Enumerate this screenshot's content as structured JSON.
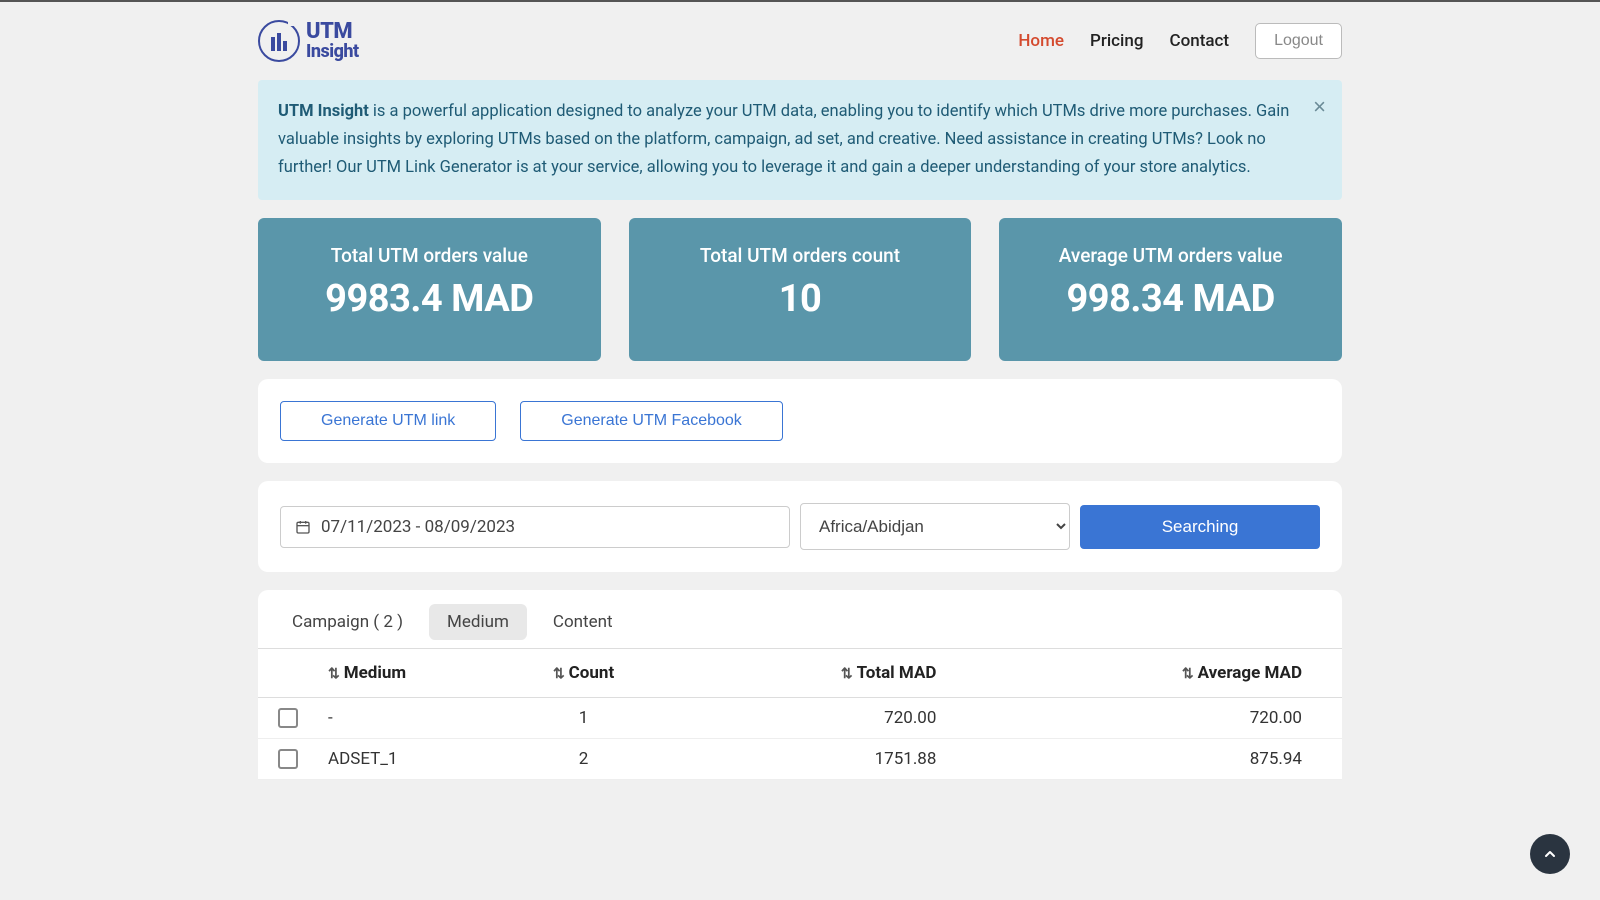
{
  "brand": {
    "line1": "UTM",
    "line2": "Insight"
  },
  "nav": {
    "home": "Home",
    "pricing": "Pricing",
    "contact": "Contact",
    "logout": "Logout"
  },
  "banner": {
    "strong": "UTM Insight",
    "rest": " is a powerful application designed to analyze your UTM data, enabling you to identify which UTMs drive more purchases. Gain valuable insights by exploring UTMs based on the platform, campaign, ad set, and creative. Need assistance in creating UTMs? Look no further! Our UTM Link Generator is at your service, allowing you to leverage it and gain a deeper understanding of your store analytics."
  },
  "stats": [
    {
      "title": "Total UTM orders value",
      "value": "9983.4 MAD"
    },
    {
      "title": "Total UTM orders count",
      "value": "10"
    },
    {
      "title": "Average UTM orders value",
      "value": "998.34 MAD"
    }
  ],
  "generate": {
    "link": "Generate UTM link",
    "facebook": "Generate UTM Facebook"
  },
  "filters": {
    "date_range": "07/11/2023 - 08/09/2023",
    "timezone": "Africa/Abidjan",
    "search": "Searching"
  },
  "tabs": {
    "campaign": "Campaign ( 2 )",
    "medium": "Medium",
    "content": "Content"
  },
  "table": {
    "headers": {
      "medium": "Medium",
      "count": "Count",
      "total": "Total MAD",
      "average": "Average MAD"
    },
    "rows": [
      {
        "medium": "-",
        "count": "1",
        "total": "720.00",
        "average": "720.00"
      },
      {
        "medium": "ADSET_1",
        "count": "2",
        "total": "1751.88",
        "average": "875.94"
      }
    ]
  }
}
